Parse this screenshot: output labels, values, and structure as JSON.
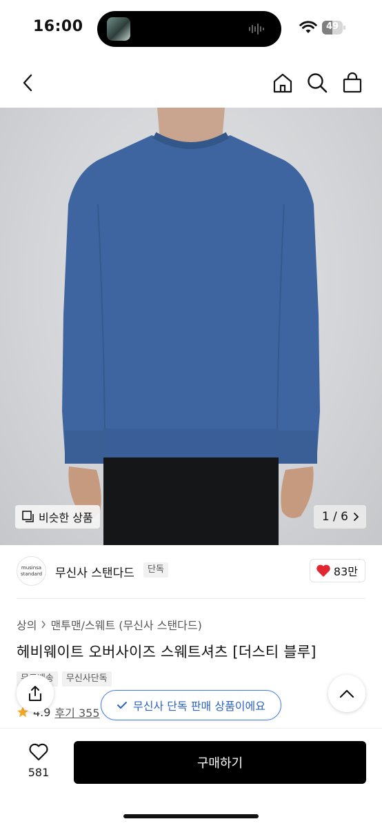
{
  "status": {
    "time": "16:00",
    "battery": "49",
    "battery_level": 0.49
  },
  "nav": {
    "back_icon": "chevron-left-icon",
    "home_icon": "home-icon",
    "search_icon": "search-icon",
    "cart_icon": "shopping-bag-icon"
  },
  "image": {
    "similar_label": "비슷한 상품",
    "page_indicator": "1 / 6",
    "sweater_color": "#3f65a0"
  },
  "brand": {
    "logo_line1": "musinsa",
    "logo_line2": "standard",
    "name": "무신사 스탠다드",
    "exclusive_tag": "단독",
    "likes": "83만"
  },
  "product": {
    "breadcrumb": [
      "상의",
      "맨투맨/스웨트 (무신사 스탠다드)"
    ],
    "title": "헤비웨이트 오버사이즈 스웨트셔츠 [더스티 블루]",
    "tags": [
      "무료배송",
      "무신사단독"
    ],
    "rating": "4.9",
    "review_label": "후기 355"
  },
  "toast": {
    "text": "무신사 단독 판매 상품이에요"
  },
  "bottom": {
    "wish_count": "581",
    "buy_label": "구매하기"
  },
  "colors": {
    "accent": "#2b63c8",
    "heart": "#e0262f",
    "buy": "#000000",
    "star": "#f5a623"
  }
}
